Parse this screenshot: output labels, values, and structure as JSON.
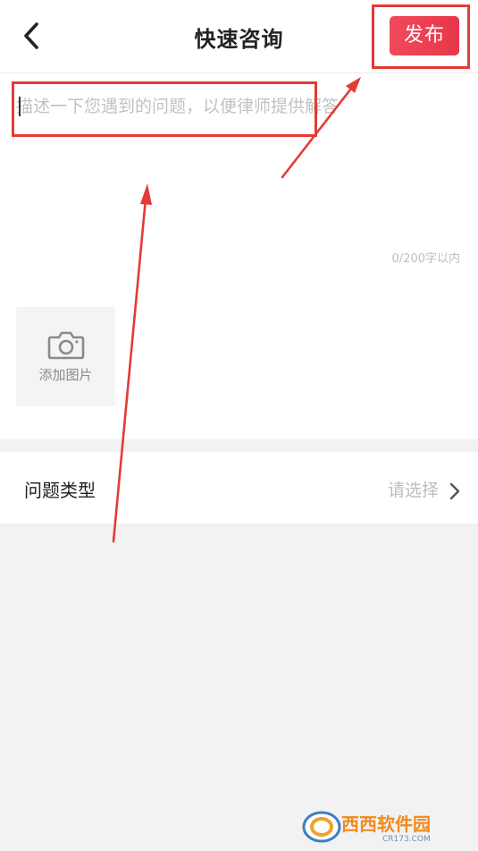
{
  "header": {
    "title": "快速咨询",
    "publish_label": "发布",
    "back_icon": "chevron-left-icon"
  },
  "editor": {
    "placeholder": "描述一下您遇到的问题，以便律师提供解答",
    "value": "",
    "counter": "0/200字以内"
  },
  "photo": {
    "label": "添加图片",
    "icon": "camera-icon"
  },
  "question_type": {
    "label": "问题类型",
    "value": "请选择",
    "icon": "chevron-right-icon"
  },
  "colors": {
    "accent": "#e8364a",
    "annotation": "#e33b37"
  },
  "watermark": {
    "text": "西西软件园",
    "sub": "CR173.COM"
  }
}
